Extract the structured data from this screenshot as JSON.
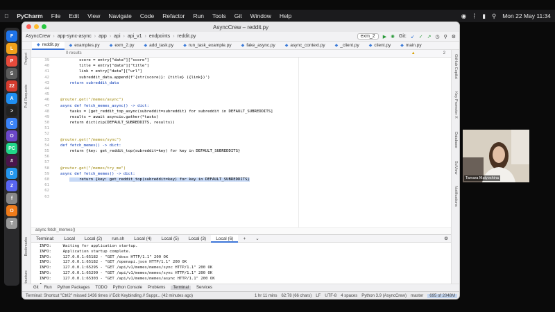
{
  "macos_menubar": {
    "app": "PyCharm",
    "items": [
      "File",
      "Edit",
      "View",
      "Navigate",
      "Code",
      "Refactor",
      "Run",
      "Tools",
      "Git",
      "Window",
      "Help"
    ],
    "clock": "Mon 22 May  11:34"
  },
  "window": {
    "title": "AsyncCrew – reddit.py",
    "breadcrumb": [
      "AsyncCrew",
      "app-sync-async",
      "app",
      "api",
      "api_v1",
      "endpoints",
      "reddit.py"
    ],
    "run_config": "exm_2",
    "git_label": "Git:"
  },
  "editor_tabs": [
    "reddit.py",
    "examples.py",
    "exm_2.py",
    "add_task.py",
    "run_task_example.py",
    "fake_async.py",
    "async_context.py",
    "_client.py",
    "client.py",
    "main.py"
  ],
  "find_bar": {
    "results": "0 results"
  },
  "inspection_count": "2",
  "code": {
    "line_numbers": [
      "39",
      "40",
      "41",
      "42",
      "43",
      "44",
      "45",
      "46",
      "47",
      "48",
      "49",
      "50",
      "51",
      "52",
      "53",
      "54",
      "55",
      "56",
      "57",
      "58",
      "59",
      "60",
      "61",
      "62",
      "63"
    ],
    "lines": [
      "        score = entry[\"data\"][\"score\"]",
      "        title = entry[\"data\"][\"title\"]",
      "        link = entry[\"data\"][\"url\"]",
      "        subreddit_data.append(f'{str(score)}: {title} ({link})')",
      "    return subreddit_data",
      "",
      "",
      "@router.get(\"/memes/async\")",
      "async def fetch_memes_async() -> dict:",
      "    tasks = [get_reddit_top_async(subreddit=subreddit) for subreddit in DEFAULT_SUBREDDITS]",
      "    results = await asyncio.gather(*tasks)",
      "    return dict(zip(DEFAULT_SUBREDDITS, results))",
      "",
      "",
      "@router.get(\"/memes/sync\")",
      "def fetch_memes() -> dict:",
      "    return {key: get_reddit_top(subreddit=key) for key in DEFAULT_SUBREDDITS}",
      "",
      "",
      "@router.get(\"/memes/try_me\")",
      "async def fetch_memes() -> dict:",
      "    return {key: get_reddit_top(subreddit=key) for key in DEFAULT_SUBREDDITS}",
      ""
    ],
    "code_breadcrumb": "async fetch_memes()"
  },
  "terminal": {
    "label": "Terminal:",
    "tabs": [
      "Local",
      "Local (2)",
      "run.sh",
      "Local (4)",
      "Local (5)",
      "Local (3)",
      "Local (6)"
    ],
    "lines": [
      "INFO:     Waiting for application startup.",
      "INFO:     Application startup complete.",
      "INFO:     127.0.0.1:65182 - \"GET /docs HTTP/1.1\" 200 OK",
      "INFO:     127.0.0.1:65182 - \"GET /openapi.json HTTP/1.1\" 200 OK",
      "INFO:     127.0.0.1:65295 - \"GET /api/v1/memes/memes/sync HTTP/1.1\" 200 OK",
      "INFO:     127.0.0.1:65299 - \"GET /api/v1/memes/memes/sync HTTP/1.1\" 200 OK",
      "INFO:     127.0.0.1:65303 - \"GET /api/v1/memes/memes/async HTTP/1.1\" 200 OK"
    ]
  },
  "tool_windows": [
    "Git",
    "Run",
    "Python Packages",
    "TODO",
    "Python Console",
    "Problems",
    "Terminal",
    "Services"
  ],
  "status_bar": {
    "left": "Terminal: Shortcut \"Ctrl2\" missed 1436 times // Edit Keybinding // Suppr... (42 minutes ago)",
    "time": "1 hr 11 mins",
    "position": "62:78 (66 chars)",
    "line_sep": "LF",
    "encoding": "UTF-8",
    "indent": "4 spaces",
    "interpreter": "Python 3.9 (AsyncCrew)",
    "branch": "master",
    "memory": "695 of 2048M"
  },
  "side_labels": {
    "left": [
      "Project",
      "Pull Requests",
      "Bookmarks",
      "Structure"
    ],
    "right": [
      "GitHub Copilot",
      "Key Promoter X",
      "Database",
      "SciView",
      "Notifications"
    ]
  },
  "webcam": {
    "name": "Tamara Matyoshina"
  }
}
